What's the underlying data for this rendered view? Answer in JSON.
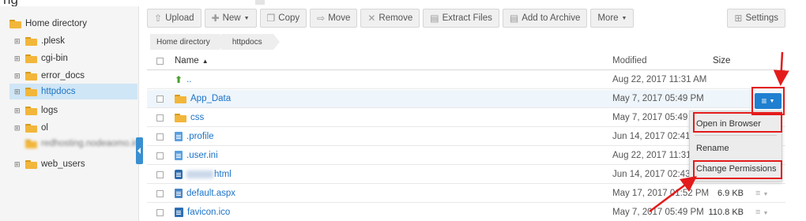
{
  "page": {
    "cut_title_fragment": "ng"
  },
  "colors": {
    "accent": "#1f7fd0",
    "folder": "#f2b63b",
    "annotation": "#e41b1b",
    "selected_bg": "#cfe6f6"
  },
  "sidebar": {
    "items": [
      {
        "label": "Home directory",
        "expander": "",
        "icon": "folder-icon"
      },
      {
        "label": ".plesk",
        "expander": "⊞",
        "icon": "folder-icon"
      },
      {
        "label": "cgi-bin",
        "expander": "⊞",
        "icon": "folder-icon"
      },
      {
        "label": "error_docs",
        "expander": "⊞",
        "icon": "folder-icon"
      },
      {
        "label": "httpdocs",
        "expander": "⊞",
        "icon": "folder-icon",
        "selected": true
      },
      {
        "label": "logs",
        "expander": "⊞",
        "icon": "folder-icon"
      },
      {
        "label": "ol",
        "expander": "⊞",
        "icon": "folder-icon"
      },
      {
        "label": "redhosting.nodeaomo.in",
        "expander": "",
        "icon": "folder-icon",
        "obscured": true
      },
      {
        "label": "web_users",
        "expander": "⊞",
        "icon": "folder-icon"
      }
    ]
  },
  "toolbar": {
    "upload": "Upload",
    "new": "New",
    "copy": "Copy",
    "move": "Move",
    "remove": "Remove",
    "extract": "Extract Files",
    "archive": "Add to Archive",
    "more": "More",
    "settings": "Settings"
  },
  "breadcrumb": [
    "Home directory",
    "httpdocs"
  ],
  "table": {
    "headers": {
      "name": "Name",
      "modified": "Modified",
      "size": "Size"
    },
    "rows": [
      {
        "name": "..",
        "modified": "Aug 22, 2017 11:31 AM",
        "size": "",
        "type": "up"
      },
      {
        "name": "App_Data",
        "modified": "May 7, 2017 05:49 PM",
        "size": "",
        "type": "folder"
      },
      {
        "name": "css",
        "modified": "May 7, 2017 05:49 P",
        "size": "",
        "type": "folder"
      },
      {
        "name": ".profile",
        "modified": "Jun 14, 2017 02:41 P",
        "size": "",
        "type": "file"
      },
      {
        "name": ".user.ini",
        "modified": "Aug 22, 2017 11:31 ,",
        "size": "",
        "type": "file"
      },
      {
        "name": "html",
        "modified": "Jun 14, 2017 02:43",
        "size": "",
        "type": "html"
      },
      {
        "name": "default.aspx",
        "modified": "May 17, 2017 01:52 PM",
        "size": "6.9 KB",
        "type": "aspx"
      },
      {
        "name": "favicon.ico",
        "modified": "May 7, 2017 05:49 PM",
        "size": "110.8 KB",
        "type": "ico"
      }
    ]
  },
  "context_menu": {
    "items": [
      "Open in Browser",
      "Rename",
      "Change Permissions"
    ]
  }
}
